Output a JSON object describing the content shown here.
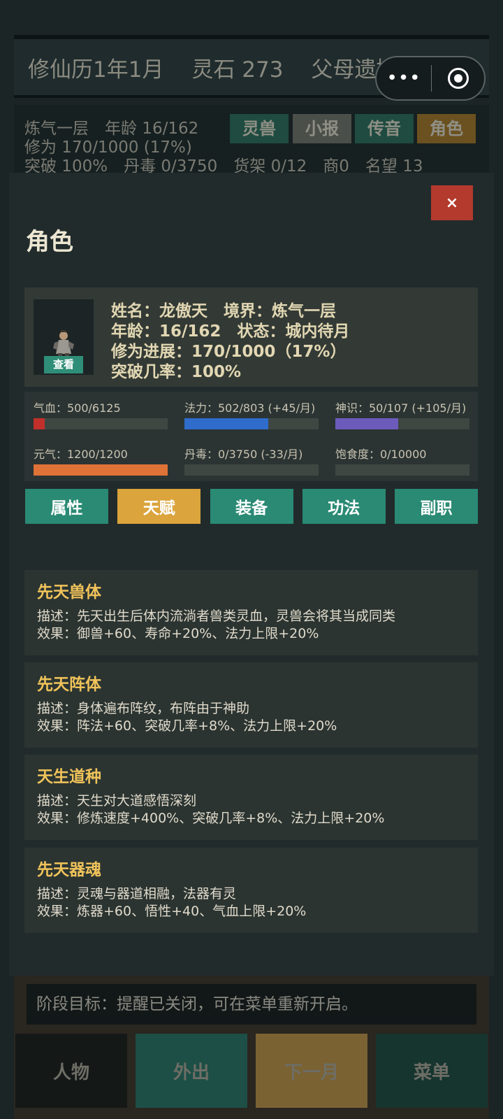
{
  "header": {
    "date": "修仙历1年1月",
    "stones": "灵石 273",
    "event": "父母遗摊"
  },
  "capsule": {
    "more": "•••"
  },
  "status": {
    "line1": "炼气一层　年龄 16/162",
    "line2": "修为 170/1000 (17%)",
    "line3": "突破 100%　丹毒 0/3750　货架 0/12　商0　名望 13"
  },
  "top_buttons": [
    {
      "label": "灵兽",
      "color": "#1f4b40"
    },
    {
      "label": "小报",
      "color": "#4b4f49"
    },
    {
      "label": "传音",
      "color": "#1f4b40"
    },
    {
      "label": "角色",
      "color": "#6b5120"
    }
  ],
  "modal": {
    "title": "角色",
    "close": "×",
    "profile": {
      "view": "查看",
      "line1": "姓名：龙傲天　境界：炼气一层",
      "line2": "年龄：16/162　状态：城内待月",
      "line3": "修为进展：170/1000（17%）",
      "line4": "突破几率：100%"
    },
    "stats": [
      {
        "label": "气血：500/6125",
        "fraction": 0.082,
        "color": "#c1302a"
      },
      {
        "label": "法力：502/803 (+45/月)",
        "fraction": 0.625,
        "color": "#2f6ccb"
      },
      {
        "label": "神识：50/107 (+105/月)",
        "fraction": 0.467,
        "color": "#6c5bbb"
      },
      {
        "label": "元气：1200/1200",
        "fraction": 1.0,
        "color": "#df7236"
      },
      {
        "label": "丹毒：0/3750 (-33/月)",
        "fraction": 0,
        "color": "#3e4742"
      },
      {
        "label": "饱食度：0/10000",
        "fraction": 0,
        "color": "#3e4742"
      }
    ],
    "tabs": [
      "属性",
      "天赋",
      "装备",
      "功法",
      "副职"
    ],
    "active_tab": "天赋",
    "talents": [
      {
        "name": "先天兽体",
        "desc": "描述：先天出生后体内流淌者兽类灵血，灵兽会将其当成同类",
        "effect": "效果：御兽+60、寿命+20%、法力上限+20%"
      },
      {
        "name": "先天阵体",
        "desc": "描述：身体遍布阵纹，布阵由于神助",
        "effect": "效果：阵法+60、突破几率+8%、法力上限+20%"
      },
      {
        "name": "天生道种",
        "desc": "描述：天生对大道感悟深刻",
        "effect": "效果：修炼速度+400%、突破几率+8%、法力上限+20%"
      },
      {
        "name": "先天器魂",
        "desc": "描述：灵魂与器道相融，法器有灵",
        "effect": "效果：炼器+60、悟性+40、气血上限+20%"
      }
    ]
  },
  "goal": "阶段目标：提醒已关闭，可在菜单重新开启。",
  "nav": [
    {
      "label": "人物",
      "color": "#141817"
    },
    {
      "label": "外出",
      "color": "#1d4f46"
    },
    {
      "label": "下一月",
      "color": "#7a6233"
    },
    {
      "label": "菜单",
      "color": "#16352f"
    }
  ]
}
